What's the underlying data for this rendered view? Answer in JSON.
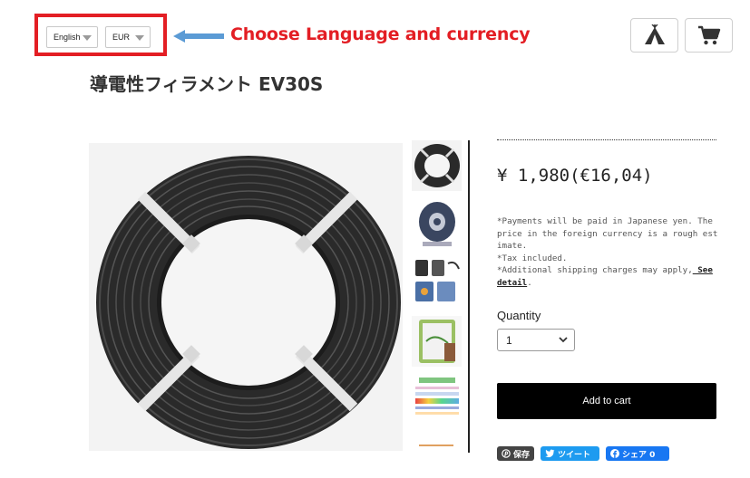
{
  "selector": {
    "language": "English",
    "currency": "EUR"
  },
  "annotation": {
    "text": "Choose Language and currency",
    "color": "#e31e24"
  },
  "header_icons": [
    "tent-icon",
    "cart-icon"
  ],
  "product": {
    "title": "導電性フィラメント EV30S",
    "price": "¥ 1,980(€16,04)",
    "notes": {
      "line1": "*Payments will be paid in Japanese yen. The price in the foreign currency is a rough estimate.",
      "line2": "*Tax included.",
      "line3": "*Additional shipping charges may apply,",
      "see_detail": " See detail",
      "line3_end": "."
    },
    "quantity_label": "Quantity",
    "quantity_value": "1",
    "add_to_cart": "Add to cart"
  },
  "share": {
    "pinterest": "保存",
    "twitter": "ツイート",
    "facebook": "シェア 0"
  },
  "thumbnails": [
    "thumb-spool-coil",
    "thumb-spool-reel",
    "thumb-printed-parts",
    "thumb-phone-photo",
    "thumb-chart",
    "thumb-partial"
  ]
}
